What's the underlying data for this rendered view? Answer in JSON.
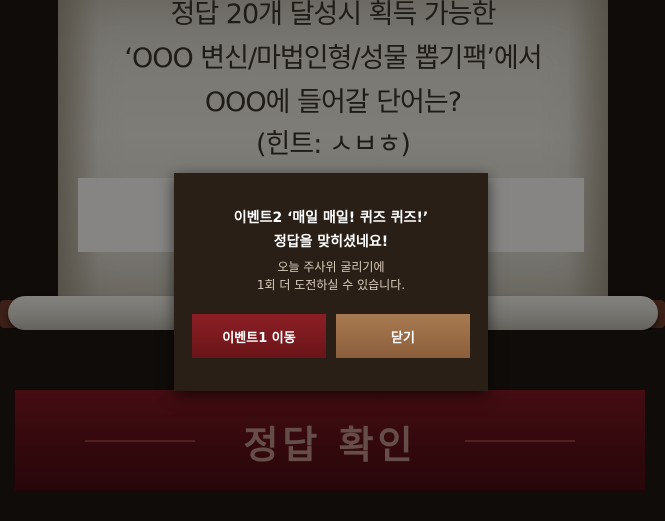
{
  "quiz": {
    "line1": "정답 20개 달성시 획득 가능한",
    "line2": "‘OOO 변신/마법인형/성물 뽑기팩’에서",
    "line3": "OOO에 들어갈 단어는?",
    "hint": "(힌트: ㅅㅂㅎ)"
  },
  "submit": {
    "label": "정답 확인"
  },
  "modal": {
    "title_line1": "이벤트2 ‘매일 매일! 퀴즈 퀴즈!’",
    "title_line2": "정답을 맞히셨네요!",
    "text_line1": "오늘 주사위 굴리기에",
    "text_line2": "1회 더 도전하실 수 있습니다.",
    "event_button": "이벤트1 이동",
    "close_button": "닫기"
  },
  "colors": {
    "modal_bg": "#2a1f16",
    "event_button": "#7a1a20",
    "close_button": "#9a6c46",
    "submit_banner": "#6a131a"
  }
}
